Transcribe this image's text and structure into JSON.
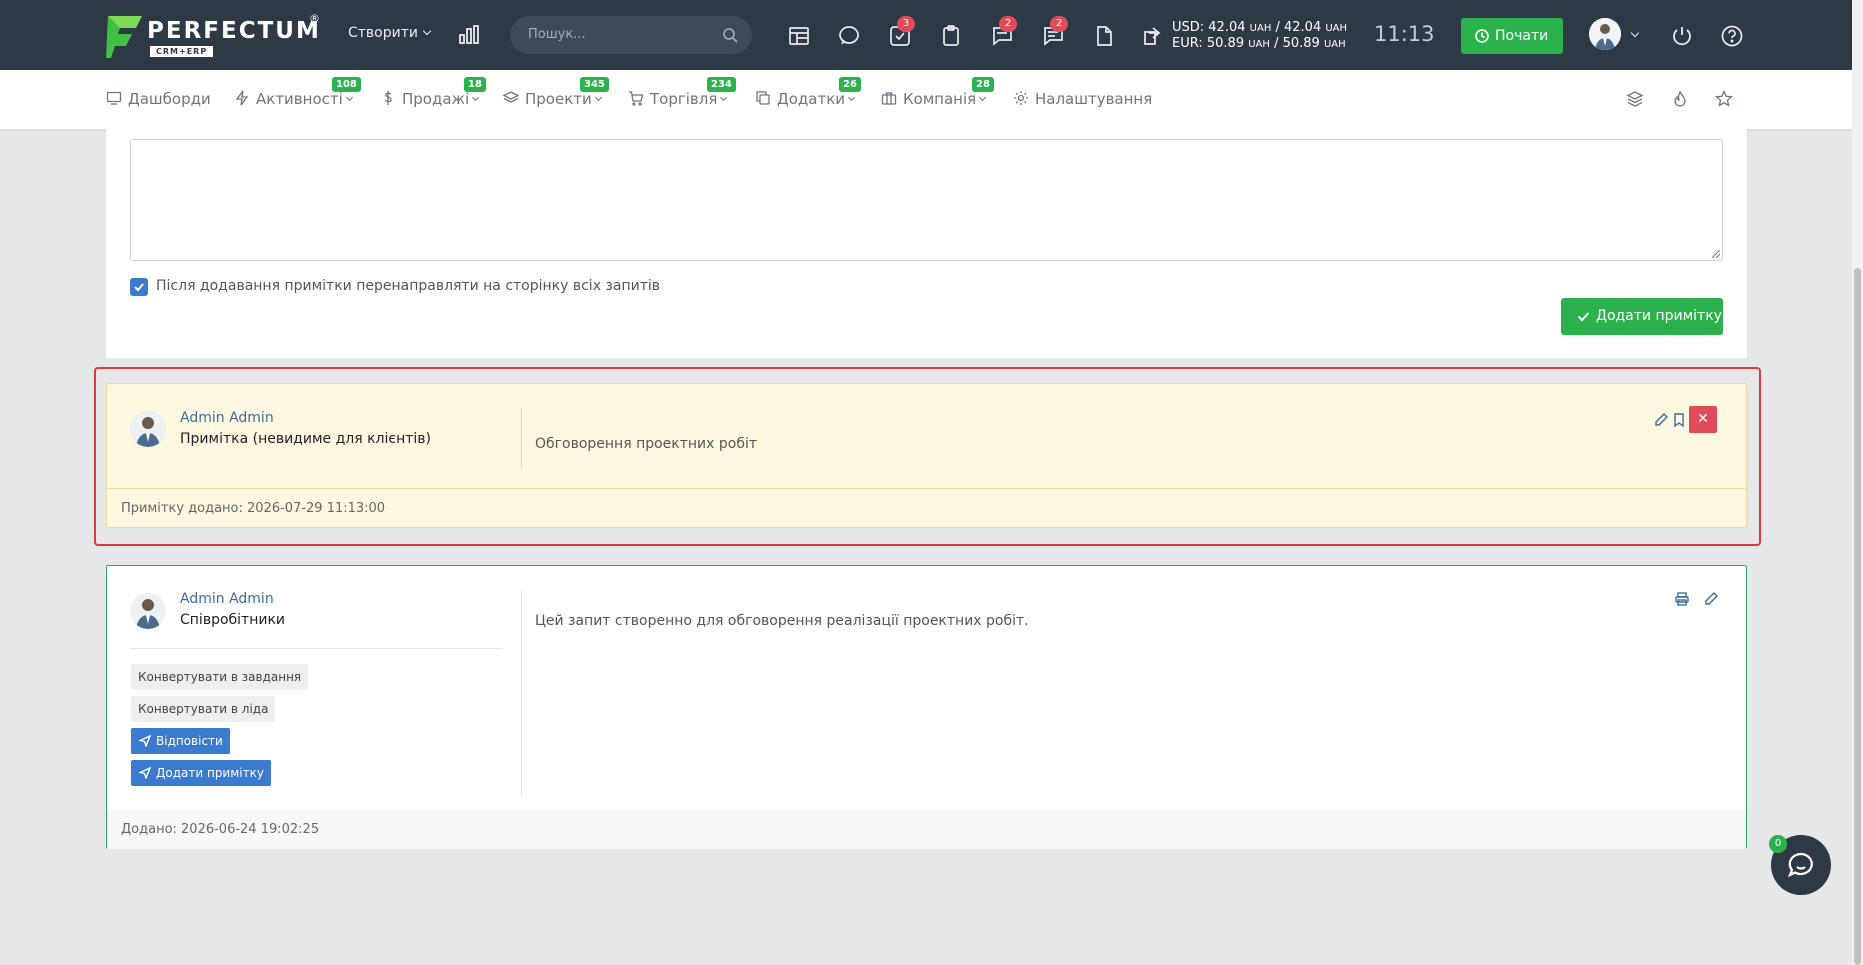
{
  "app": {
    "brand": "PERFECTUM",
    "brand_mark": "®",
    "brand_sub": "CRM+ERP"
  },
  "topbar": {
    "create_label": "Створити",
    "search_placeholder": "Пошук...",
    "badges": {
      "tasks": "3",
      "messages": "2",
      "comments": "2"
    },
    "currency": {
      "usd": "USD: 42.04",
      "eur": "EUR: 50.89",
      "usd_rate2": "/ 42.04",
      "eur_rate2": "/ 50.89",
      "unit": "UAH"
    },
    "time": "11:13",
    "start_label": "Почати"
  },
  "nav": {
    "items": [
      {
        "label": "Дашборди",
        "icon": "monitor-icon"
      },
      {
        "label": "Активності",
        "badge": "108",
        "icon": "lightning-icon"
      },
      {
        "label": "Продажі",
        "badge": "18",
        "icon": "dollar-icon"
      },
      {
        "label": "Проекти",
        "badge": "345",
        "icon": "layers-icon"
      },
      {
        "label": "Торгівля",
        "badge": "234",
        "icon": "cart-icon"
      },
      {
        "label": "Додатки",
        "badge": "26",
        "icon": "copy-icon"
      },
      {
        "label": "Компанія",
        "badge": "28",
        "icon": "briefcase-icon"
      },
      {
        "label": "Налаштування",
        "icon": "gear-icon"
      }
    ]
  },
  "form": {
    "textarea_value": "",
    "redirect_checkbox_label": "Після додавання примітки перенаправляти на сторінку всіх запитів",
    "redirect_checked": true,
    "add_note_label": "Додати примітку"
  },
  "note": {
    "author": "Admin Admin",
    "type": "Примітка (невидиме для клієнтів)",
    "text": "Обговорення проектних робіт",
    "footer": "Примітку додано: 2026-07-29 11:13:00",
    "delete_glyph": "✕"
  },
  "request": {
    "author": "Admin Admin",
    "department": "Співробітники",
    "text": "Цей запит створенно для обговорення реалізації проектних робіт.",
    "convert_task_label": "Конвертувати в завдання",
    "convert_lead_label": "Конвертувати в ліда",
    "reply_label": "Відповісти",
    "add_note_label": "Додати примітку",
    "footer": "Додано: 2026-06-24 19:02:25"
  },
  "chat": {
    "badge": "0"
  },
  "colors": {
    "topbar": "#2d3a45",
    "green": "#2bb24c",
    "blue": "#3a7bd0",
    "red": "#e04b59",
    "note_bg": "#fff8e1",
    "highlight": "#e0383e"
  }
}
